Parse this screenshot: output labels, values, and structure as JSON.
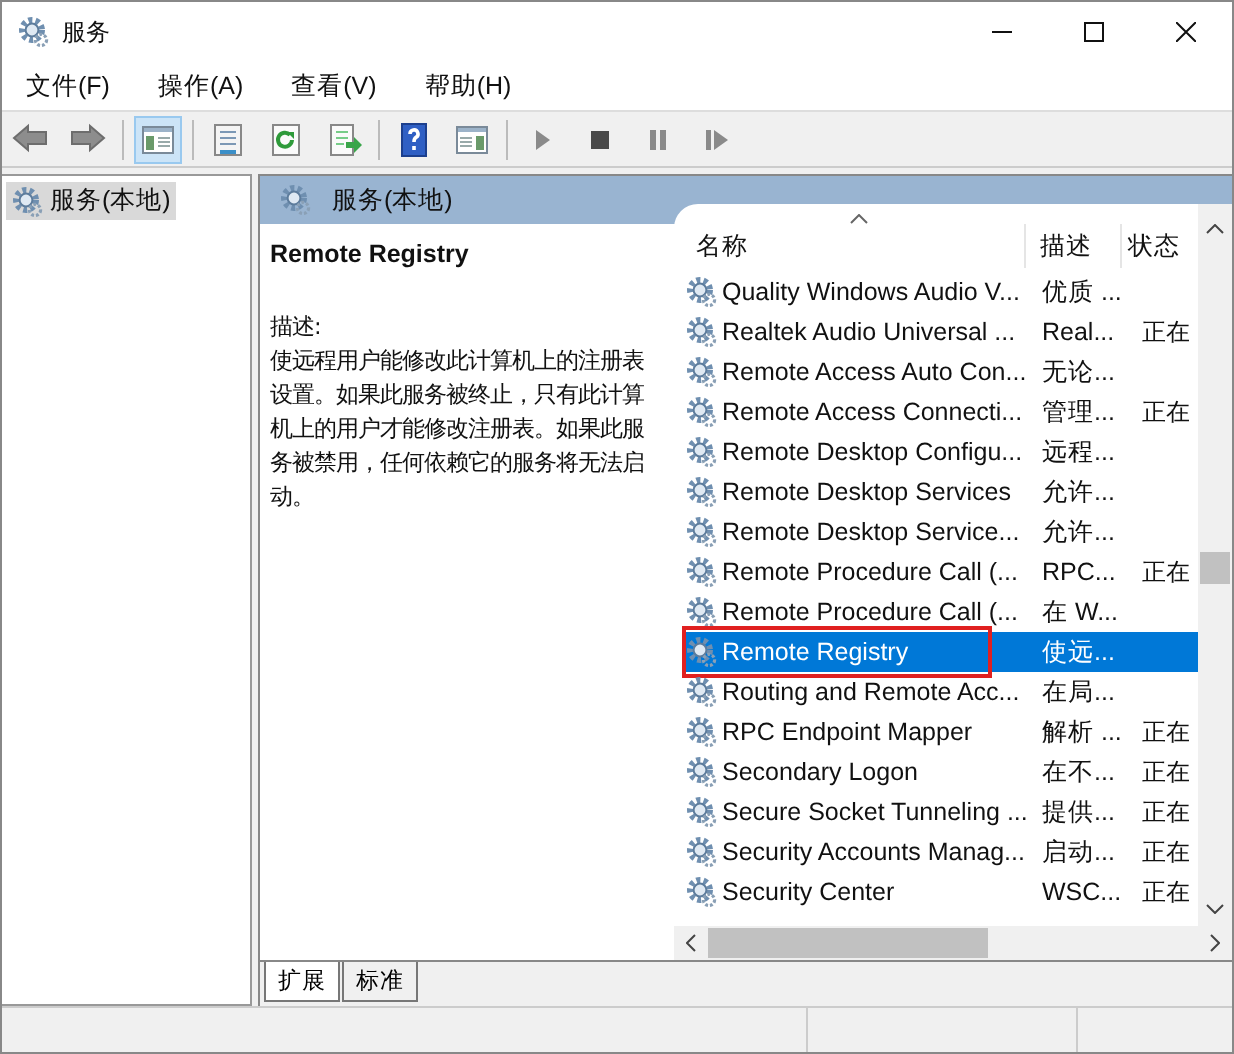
{
  "window": {
    "title": "服务"
  },
  "menu": [
    "文件(F)",
    "操作(A)",
    "查看(V)",
    "帮助(H)"
  ],
  "toolbar": [
    {
      "kind": "back"
    },
    {
      "kind": "forward"
    },
    {
      "kind": "sep"
    },
    {
      "kind": "tree",
      "selected": true
    },
    {
      "kind": "sep"
    },
    {
      "kind": "properties"
    },
    {
      "kind": "refresh"
    },
    {
      "kind": "export"
    },
    {
      "kind": "sep"
    },
    {
      "kind": "help"
    },
    {
      "kind": "pane"
    },
    {
      "kind": "sep"
    },
    {
      "kind": "play"
    },
    {
      "kind": "stop"
    },
    {
      "kind": "pause"
    },
    {
      "kind": "resume"
    }
  ],
  "tree": [
    {
      "label": "服务(本地)",
      "selected": true
    }
  ],
  "panel": {
    "title": "服务(本地)",
    "detail": {
      "name": "Remote Registry",
      "description_label": "描述:",
      "description": "使远程用户能修改此计算机上的注册表设置。如果此服务被终止，只有此计算机上的用户才能修改注册表。如果此服务被禁用，任何依赖它的服务将无法启动。"
    },
    "columns": [
      "名称",
      "描述",
      "状态"
    ],
    "rows": [
      {
        "name": "Quality Windows Audio V...",
        "description": "优质 ...",
        "selected": false
      },
      {
        "name": "Realtek Audio Universal ...",
        "description": "Real...",
        "status": "正在",
        "selected": false
      },
      {
        "name": "Remote Access Auto Con...",
        "description": "无论...",
        "selected": false
      },
      {
        "name": "Remote Access Connecti...",
        "description": "管理...",
        "status": "正在",
        "selected": false
      },
      {
        "name": "Remote Desktop Configu...",
        "description": "远程...",
        "selected": false
      },
      {
        "name": "Remote Desktop Services",
        "description": "允许...",
        "selected": false
      },
      {
        "name": "Remote Desktop Service...",
        "description": "允许...",
        "selected": false
      },
      {
        "name": "Remote Procedure Call (...",
        "description": "RPC...",
        "status": "正在",
        "selected": false
      },
      {
        "name": "Remote Procedure Call (...",
        "description": "在 W...",
        "selected": false
      },
      {
        "name": "Remote Registry",
        "description": "使远...",
        "selected": true
      },
      {
        "name": "Routing and Remote Acc...",
        "description": "在局...",
        "selected": false
      },
      {
        "name": "RPC Endpoint Mapper",
        "description": "解析 ...",
        "status": "正在",
        "selected": false
      },
      {
        "name": "Secondary Logon",
        "description": "在不...",
        "status": "正在",
        "selected": false
      },
      {
        "name": "Secure Socket Tunneling ...",
        "description": "提供...",
        "status": "正在",
        "selected": false
      },
      {
        "name": "Security Accounts Manag...",
        "description": "启动...",
        "status": "正在",
        "selected": false
      },
      {
        "name": "Security Center",
        "description": "WSC...",
        "status": "正在",
        "selected": false
      }
    ],
    "view_tabs": [
      {
        "label": "扩展",
        "selected": true
      },
      {
        "label": "标准",
        "selected": false
      }
    ]
  }
}
